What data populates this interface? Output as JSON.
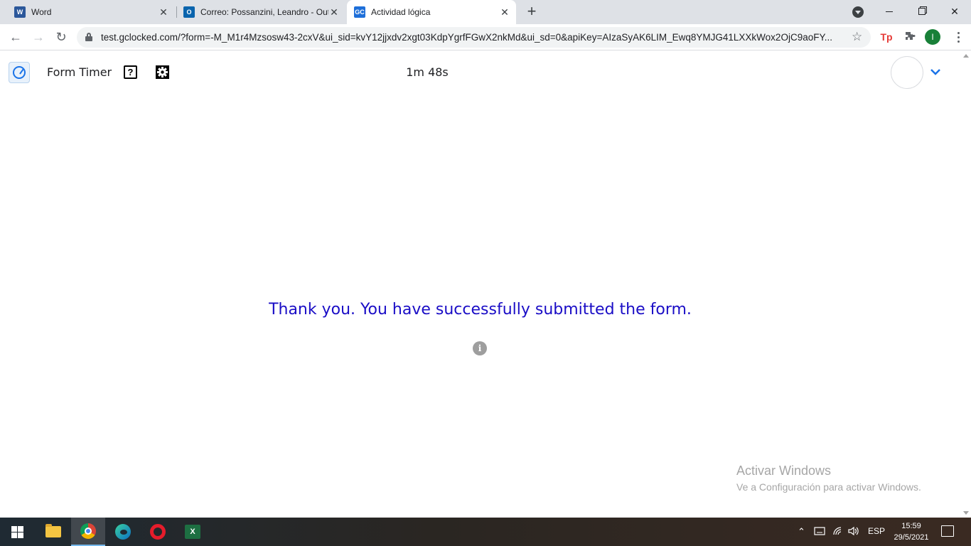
{
  "browser": {
    "tabs": [
      {
        "label": "Word",
        "icon": "word-icon",
        "active": false
      },
      {
        "label": "Correo: Possanzini, Leandro - Out",
        "icon": "outlook-icon",
        "active": false
      },
      {
        "label": "Actividad lógica",
        "icon": "gc-icon",
        "active": true
      }
    ],
    "new_tab_label": "+",
    "url": "test.gclocked.com/?form=-M_M1r4Mzsosw43-2cxV&ui_sid=kvY12jjxdv2xgt03KdpYgrfFGwX2nkMd&ui_sd=0&apiKey=AIzaSyAK6LIM_Ewq8YMJG41LXXkWox2OjC9aoFY...",
    "profile_initial": "I",
    "extension_label": "Tp",
    "colors": {
      "tabstrip": "#dee1e6",
      "profile": "#188038",
      "ext": "#e53935"
    }
  },
  "app": {
    "title": "Form Timer",
    "help_glyph": "?",
    "timer": "1m 48s"
  },
  "content": {
    "message": "Thank you. You have successfully submitted the form.",
    "info_glyph": "i",
    "message_color": "#1a0dc6"
  },
  "watermark": {
    "title": "Activar Windows",
    "subtitle": "Ve a Configuración para activar Windows."
  },
  "taskbar": {
    "apps": [
      "start",
      "file-explorer",
      "chrome",
      "edge",
      "opera",
      "excel"
    ],
    "active_app": "chrome",
    "excel_label": "X",
    "language": "ESP",
    "time": "15:59",
    "date": "29/5/2021"
  }
}
